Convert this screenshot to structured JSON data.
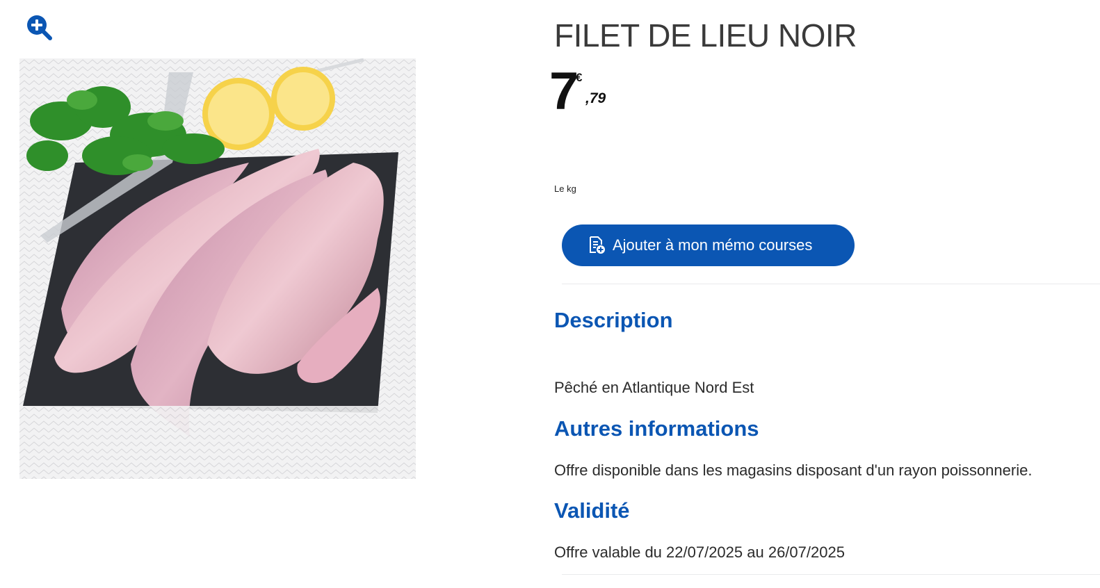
{
  "icons": {
    "zoom": "zoom-in-icon",
    "memo": "shopping-list-add-icon"
  },
  "colors": {
    "accent": "#0b56b3",
    "text": "#2b2b2b"
  },
  "product": {
    "title": "FILET DE LIEU NOIR",
    "price_int": "7",
    "price_currency": "€",
    "price_dec": ",79",
    "unit": "Le kg"
  },
  "actions": {
    "memo_label": "Ajouter à mon mémo courses"
  },
  "sections": {
    "description": {
      "title": "Description",
      "text": "Pêché en Atlantique Nord Est"
    },
    "other": {
      "title": "Autres informations",
      "text": "Offre disponible dans les magasins disposant d'un rayon poissonnerie."
    },
    "validity": {
      "title": "Validité",
      "text": "Offre valable du 22/07/2025 au 26/07/2025"
    }
  }
}
